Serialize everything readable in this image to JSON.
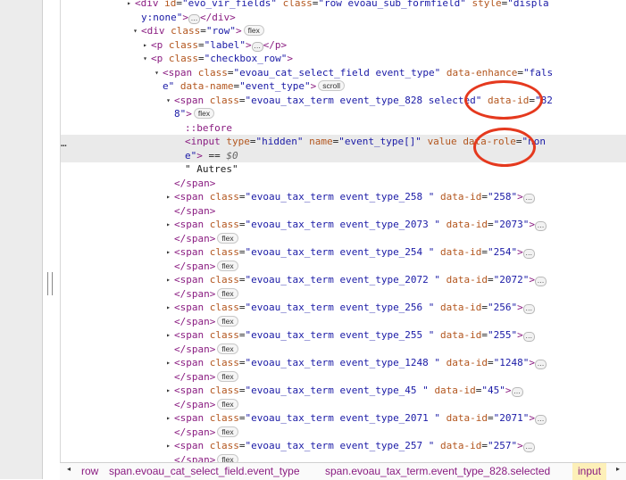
{
  "dom_lines": [
    {
      "indent": 150,
      "tri": "▸",
      "parts": [
        [
          "tag",
          "<div "
        ],
        [
          "attr",
          "id"
        ],
        [
          "txt",
          "="
        ],
        [
          "val",
          "\"evo_vir_fields\""
        ],
        [
          "txt",
          " "
        ],
        [
          "attr",
          "class"
        ],
        [
          "txt",
          "="
        ],
        [
          "val",
          "\"row evoau_sub_formfield\""
        ],
        [
          "txt",
          " "
        ],
        [
          "attr",
          "style"
        ],
        [
          "txt",
          "="
        ],
        [
          "val",
          "\"displa"
        ]
      ]
    },
    {
      "indent": 157,
      "parts": [
        [
          "val",
          "y:none\""
        ],
        [
          "tag",
          ">"
        ],
        [
          "ell",
          "…"
        ],
        [
          "tag",
          "</div>"
        ]
      ]
    },
    {
      "indent": 157,
      "tri": "▾",
      "parts": [
        [
          "tag",
          "<div "
        ],
        [
          "attr",
          "class"
        ],
        [
          "txt",
          "="
        ],
        [
          "val",
          "\"row\""
        ],
        [
          "tag",
          ">"
        ],
        [
          "badge",
          "flex"
        ]
      ]
    },
    {
      "indent": 168,
      "tri": "▸",
      "parts": [
        [
          "tag",
          "<p "
        ],
        [
          "attr",
          "class"
        ],
        [
          "txt",
          "="
        ],
        [
          "val",
          "\"label\""
        ],
        [
          "tag",
          ">"
        ],
        [
          "ell",
          "…"
        ],
        [
          "tag",
          "</p>"
        ]
      ]
    },
    {
      "indent": 168,
      "tri": "▾",
      "parts": [
        [
          "tag",
          "<p "
        ],
        [
          "attr",
          "class"
        ],
        [
          "txt",
          "="
        ],
        [
          "val",
          "\"checkbox_row\""
        ],
        [
          "tag",
          ">"
        ]
      ]
    },
    {
      "indent": 181,
      "tri": "▾",
      "parts": [
        [
          "tag",
          "<span "
        ],
        [
          "attr",
          "class"
        ],
        [
          "txt",
          "="
        ],
        [
          "val",
          "\"evoau_cat_select_field event_type\""
        ],
        [
          "txt",
          " "
        ],
        [
          "attr",
          "data-enhance"
        ],
        [
          "txt",
          "="
        ],
        [
          "val",
          "\"fals"
        ]
      ]
    },
    {
      "indent": 181,
      "parts": [
        [
          "val",
          "e\""
        ],
        [
          "txt",
          " "
        ],
        [
          "attr",
          "data-name"
        ],
        [
          "txt",
          "="
        ],
        [
          "val",
          "\"event_type\""
        ],
        [
          "tag",
          ">"
        ],
        [
          "badge",
          "scroll"
        ]
      ]
    },
    {
      "indent": 194,
      "tri": "▾",
      "parts": [
        [
          "tag",
          "<span "
        ],
        [
          "attr",
          "class"
        ],
        [
          "txt",
          "="
        ],
        [
          "val",
          "\"evoau_tax_term event_type_828 selected\""
        ],
        [
          "txt",
          " "
        ],
        [
          "attr",
          "data-id"
        ],
        [
          "txt",
          "="
        ],
        [
          "val",
          "\"82"
        ]
      ]
    },
    {
      "indent": 194,
      "parts": [
        [
          "val",
          "8\""
        ],
        [
          "tag",
          ">"
        ],
        [
          "badge",
          "flex"
        ]
      ]
    },
    {
      "indent": 206,
      "parts": [
        [
          "pseudo",
          "::before"
        ]
      ]
    },
    {
      "indent": 206,
      "hl": true,
      "parts": [
        [
          "tag",
          "<input "
        ],
        [
          "attr",
          "type"
        ],
        [
          "txt",
          "="
        ],
        [
          "val",
          "\"hidden\""
        ],
        [
          "txt",
          " "
        ],
        [
          "attr",
          "name"
        ],
        [
          "txt",
          "="
        ],
        [
          "val",
          "\"event_type[]\""
        ],
        [
          "txt",
          " "
        ],
        [
          "attr",
          "value"
        ],
        [
          "txt",
          " "
        ],
        [
          "attr",
          "data-role"
        ],
        [
          "txt",
          "="
        ],
        [
          "val",
          "\"non"
        ]
      ]
    },
    {
      "indent": 206,
      "hl": true,
      "parts": [
        [
          "val",
          "e\""
        ],
        [
          "tag",
          ">"
        ],
        [
          "txt",
          " == "
        ],
        [
          "dim",
          "$0"
        ]
      ]
    },
    {
      "indent": 206,
      "parts": [
        [
          "txt",
          "\" Autres\""
        ]
      ]
    },
    {
      "indent": 194,
      "parts": [
        [
          "tag",
          "</span>"
        ]
      ]
    },
    {
      "indent": 194,
      "tri": "▸",
      "parts": [
        [
          "tag",
          "<span "
        ],
        [
          "attr",
          "class"
        ],
        [
          "txt",
          "="
        ],
        [
          "val",
          "\"evoau_tax_term event_type_258 \""
        ],
        [
          "txt",
          " "
        ],
        [
          "attr",
          "data-id"
        ],
        [
          "txt",
          "="
        ],
        [
          "val",
          "\"258\""
        ],
        [
          "tag",
          ">"
        ],
        [
          "ell",
          "…"
        ]
      ]
    },
    {
      "indent": 194,
      "parts": [
        [
          "tag",
          "</span>"
        ]
      ]
    },
    {
      "indent": 194,
      "tri": "▸",
      "parts": [
        [
          "tag",
          "<span "
        ],
        [
          "attr",
          "class"
        ],
        [
          "txt",
          "="
        ],
        [
          "val",
          "\"evoau_tax_term event_type_2073 \""
        ],
        [
          "txt",
          " "
        ],
        [
          "attr",
          "data-id"
        ],
        [
          "txt",
          "="
        ],
        [
          "val",
          "\"2073\""
        ],
        [
          "tag",
          ">"
        ],
        [
          "ell",
          "…"
        ]
      ]
    },
    {
      "indent": 194,
      "parts": [
        [
          "tag",
          "</span>"
        ],
        [
          "badge",
          "flex"
        ]
      ]
    },
    {
      "indent": 194,
      "tri": "▸",
      "parts": [
        [
          "tag",
          "<span "
        ],
        [
          "attr",
          "class"
        ],
        [
          "txt",
          "="
        ],
        [
          "val",
          "\"evoau_tax_term event_type_254 \""
        ],
        [
          "txt",
          " "
        ],
        [
          "attr",
          "data-id"
        ],
        [
          "txt",
          "="
        ],
        [
          "val",
          "\"254\""
        ],
        [
          "tag",
          ">"
        ],
        [
          "ell",
          "…"
        ]
      ]
    },
    {
      "indent": 194,
      "parts": [
        [
          "tag",
          "</span>"
        ],
        [
          "badge",
          "flex"
        ]
      ]
    },
    {
      "indent": 194,
      "tri": "▸",
      "parts": [
        [
          "tag",
          "<span "
        ],
        [
          "attr",
          "class"
        ],
        [
          "txt",
          "="
        ],
        [
          "val",
          "\"evoau_tax_term event_type_2072 \""
        ],
        [
          "txt",
          " "
        ],
        [
          "attr",
          "data-id"
        ],
        [
          "txt",
          "="
        ],
        [
          "val",
          "\"2072\""
        ],
        [
          "tag",
          ">"
        ],
        [
          "ell",
          "…"
        ]
      ]
    },
    {
      "indent": 194,
      "parts": [
        [
          "tag",
          "</span>"
        ],
        [
          "badge",
          "flex"
        ]
      ]
    },
    {
      "indent": 194,
      "tri": "▸",
      "parts": [
        [
          "tag",
          "<span "
        ],
        [
          "attr",
          "class"
        ],
        [
          "txt",
          "="
        ],
        [
          "val",
          "\"evoau_tax_term event_type_256 \""
        ],
        [
          "txt",
          " "
        ],
        [
          "attr",
          "data-id"
        ],
        [
          "txt",
          "="
        ],
        [
          "val",
          "\"256\""
        ],
        [
          "tag",
          ">"
        ],
        [
          "ell",
          "…"
        ]
      ]
    },
    {
      "indent": 194,
      "parts": [
        [
          "tag",
          "</span>"
        ],
        [
          "badge",
          "flex"
        ]
      ]
    },
    {
      "indent": 194,
      "tri": "▸",
      "parts": [
        [
          "tag",
          "<span "
        ],
        [
          "attr",
          "class"
        ],
        [
          "txt",
          "="
        ],
        [
          "val",
          "\"evoau_tax_term event_type_255 \""
        ],
        [
          "txt",
          " "
        ],
        [
          "attr",
          "data-id"
        ],
        [
          "txt",
          "="
        ],
        [
          "val",
          "\"255\""
        ],
        [
          "tag",
          ">"
        ],
        [
          "ell",
          "…"
        ]
      ]
    },
    {
      "indent": 194,
      "parts": [
        [
          "tag",
          "</span>"
        ],
        [
          "badge",
          "flex"
        ]
      ]
    },
    {
      "indent": 194,
      "tri": "▸",
      "parts": [
        [
          "tag",
          "<span "
        ],
        [
          "attr",
          "class"
        ],
        [
          "txt",
          "="
        ],
        [
          "val",
          "\"evoau_tax_term event_type_1248 \""
        ],
        [
          "txt",
          " "
        ],
        [
          "attr",
          "data-id"
        ],
        [
          "txt",
          "="
        ],
        [
          "val",
          "\"1248\""
        ],
        [
          "tag",
          ">"
        ],
        [
          "ell",
          "…"
        ]
      ]
    },
    {
      "indent": 194,
      "parts": [
        [
          "tag",
          "</span>"
        ],
        [
          "badge",
          "flex"
        ]
      ]
    },
    {
      "indent": 194,
      "tri": "▸",
      "parts": [
        [
          "tag",
          "<span "
        ],
        [
          "attr",
          "class"
        ],
        [
          "txt",
          "="
        ],
        [
          "val",
          "\"evoau_tax_term event_type_45 \""
        ],
        [
          "txt",
          " "
        ],
        [
          "attr",
          "data-id"
        ],
        [
          "txt",
          "="
        ],
        [
          "val",
          "\"45\""
        ],
        [
          "tag",
          ">"
        ],
        [
          "ell",
          "…"
        ]
      ]
    },
    {
      "indent": 194,
      "parts": [
        [
          "tag",
          "</span>"
        ],
        [
          "badge",
          "flex"
        ]
      ]
    },
    {
      "indent": 194,
      "tri": "▸",
      "parts": [
        [
          "tag",
          "<span "
        ],
        [
          "attr",
          "class"
        ],
        [
          "txt",
          "="
        ],
        [
          "val",
          "\"evoau_tax_term event_type_2071 \""
        ],
        [
          "txt",
          " "
        ],
        [
          "attr",
          "data-id"
        ],
        [
          "txt",
          "="
        ],
        [
          "val",
          "\"2071\""
        ],
        [
          "tag",
          ">"
        ],
        [
          "ell",
          "…"
        ]
      ]
    },
    {
      "indent": 194,
      "parts": [
        [
          "tag",
          "</span>"
        ],
        [
          "badge",
          "flex"
        ]
      ]
    },
    {
      "indent": 194,
      "tri": "▸",
      "parts": [
        [
          "tag",
          "<span "
        ],
        [
          "attr",
          "class"
        ],
        [
          "txt",
          "="
        ],
        [
          "val",
          "\"evoau_tax_term event_type_257 \""
        ],
        [
          "txt",
          " "
        ],
        [
          "attr",
          "data-id"
        ],
        [
          "txt",
          "="
        ],
        [
          "val",
          "\"257\""
        ],
        [
          "tag",
          ">"
        ],
        [
          "ell",
          "…"
        ]
      ]
    },
    {
      "indent": 194,
      "parts": [
        [
          "tag",
          "</span>"
        ],
        [
          "badge",
          "flex"
        ]
      ]
    }
  ],
  "gutter_ellipsis": "…",
  "breadcrumb": {
    "items": [
      "row",
      "span.evoau_cat_select_field.event_type",
      "span.evoau_tax_term.event_type_828.selected",
      "input"
    ],
    "back_arrow": "◂",
    "forward_arrow": "▸"
  },
  "colors": {
    "tag": "#8a1c81",
    "attr": "#b3561e",
    "value": "#1a1aa6",
    "highlight": "#eaeaea",
    "annotation_circle": "#e5391e",
    "breadcrumb_selected": "#fdf0b8"
  }
}
